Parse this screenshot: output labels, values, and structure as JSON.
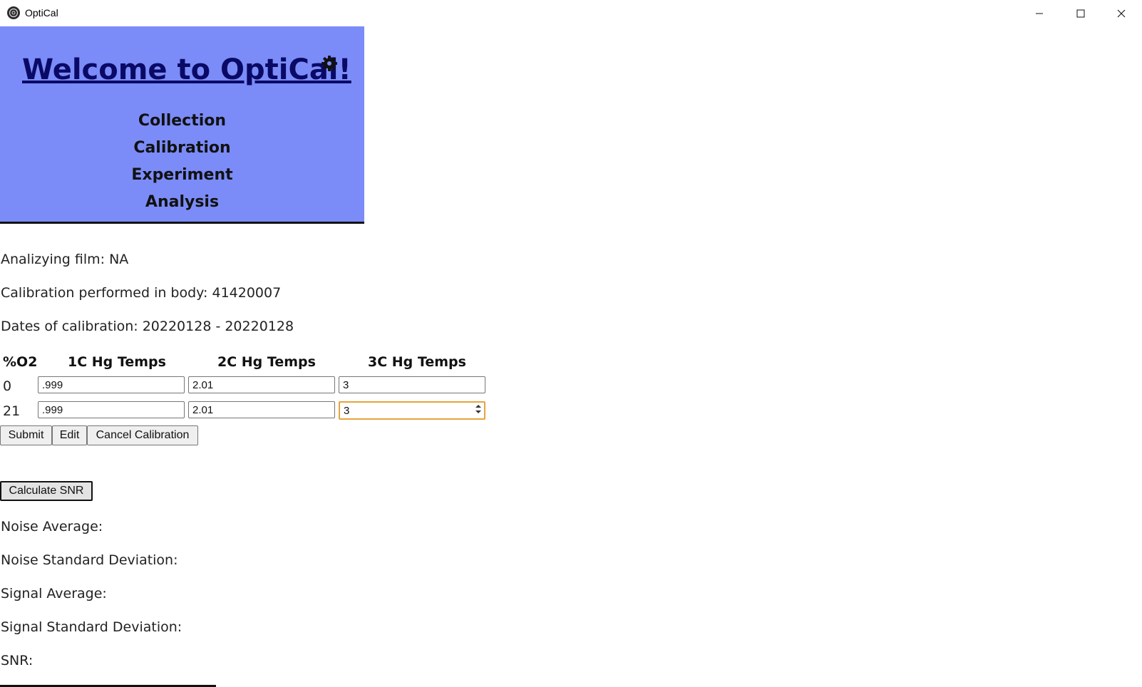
{
  "window": {
    "title": "OptiCal"
  },
  "header": {
    "title": "Welcome to OptiCal!",
    "nav": [
      "Collection",
      "Calibration",
      "Experiment",
      "Analysis"
    ]
  },
  "info": {
    "film": "Analizying film: NA",
    "body": "Calibration performed in body: 41420007",
    "dates": "Dates of calibration: 20220128 - 20220128"
  },
  "table": {
    "headers": [
      "%O2",
      "1C Hg Temps",
      "2C Hg Temps",
      "3C Hg Temps"
    ],
    "rows": [
      {
        "label": "0",
        "values": [
          ".999",
          "2.01",
          "3"
        ]
      },
      {
        "label": "21",
        "values": [
          ".999",
          "2.01",
          "3"
        ]
      }
    ]
  },
  "buttons": {
    "submit": "Submit",
    "edit": "Edit",
    "cancel": "Cancel Calibration",
    "snr": "Calculate SNR"
  },
  "results": {
    "noise_avg": "Noise Average:",
    "noise_std": "Noise Standard Deviation:",
    "signal_avg": "Signal Average:",
    "signal_std": "Signal Standard Deviation:",
    "snr": "SNR:"
  },
  "icons": {
    "app": "app-logo-icon",
    "settings": "gear-icon",
    "minimize": "minimize-icon",
    "maximize": "maximize-icon",
    "close": "close-icon"
  },
  "colors": {
    "header_bg": "#7b8cf8",
    "welcome_link": "#0a0a66",
    "focus_border": "#e8a33d"
  }
}
